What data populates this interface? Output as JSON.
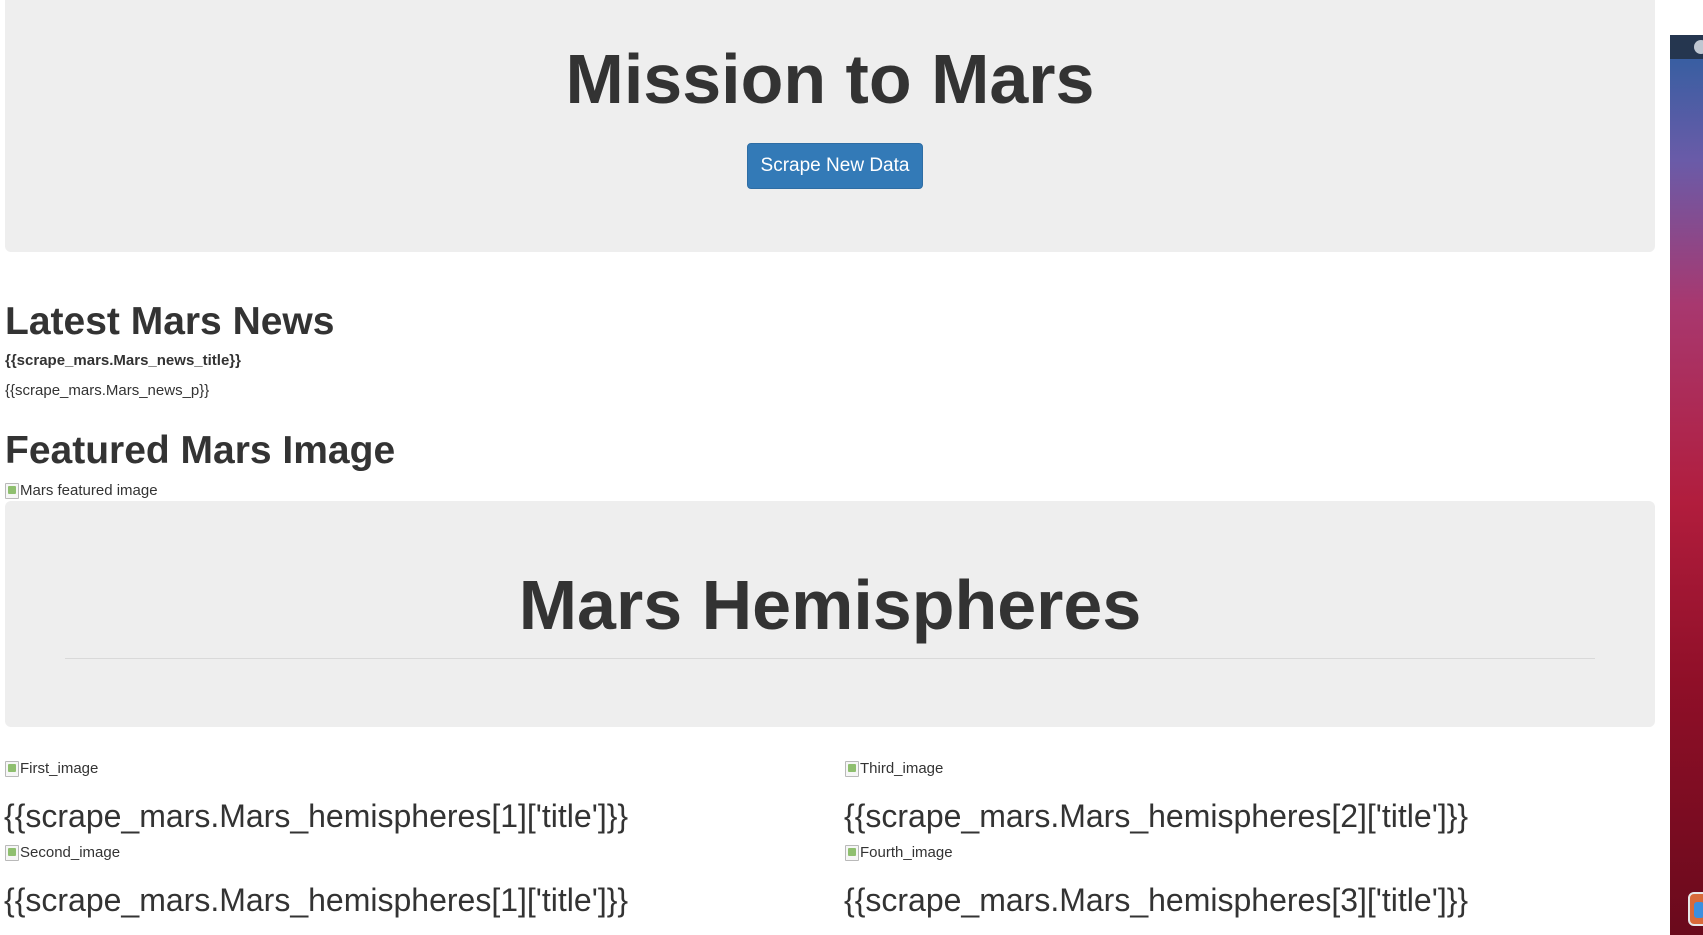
{
  "header": {
    "title": "Mission to Mars",
    "scrape_button_label": "Scrape New Data"
  },
  "news": {
    "heading": "Latest Mars News",
    "title_placeholder": "{{scrape_mars.Mars_news_title}}",
    "paragraph_placeholder": "{{scrape_mars.Mars_news_p}}"
  },
  "featured": {
    "heading": "Featured Mars Image",
    "image_alt": "Mars featured image"
  },
  "hemispheres": {
    "heading": "Mars Hemispheres",
    "items": [
      {
        "image_alt": "First_image",
        "title": "{{scrape_mars.Mars_hemispheres[1]['title']}}"
      },
      {
        "image_alt": "Second_image",
        "title": "{{scrape_mars.Mars_hemispheres[1]['title']}}"
      },
      {
        "image_alt": "Third_image",
        "title": "{{scrape_mars.Mars_hemispheres[2]['title']}}"
      },
      {
        "image_alt": "Fourth_image",
        "title": "{{scrape_mars.Mars_hemispheres[3]['title']}}"
      }
    ]
  },
  "colors": {
    "jumbotron_bg": "#eeeeee",
    "primary_button": "#337ab7",
    "text": "#333333"
  },
  "icons": {
    "broken_image": "broken-image-icon"
  }
}
